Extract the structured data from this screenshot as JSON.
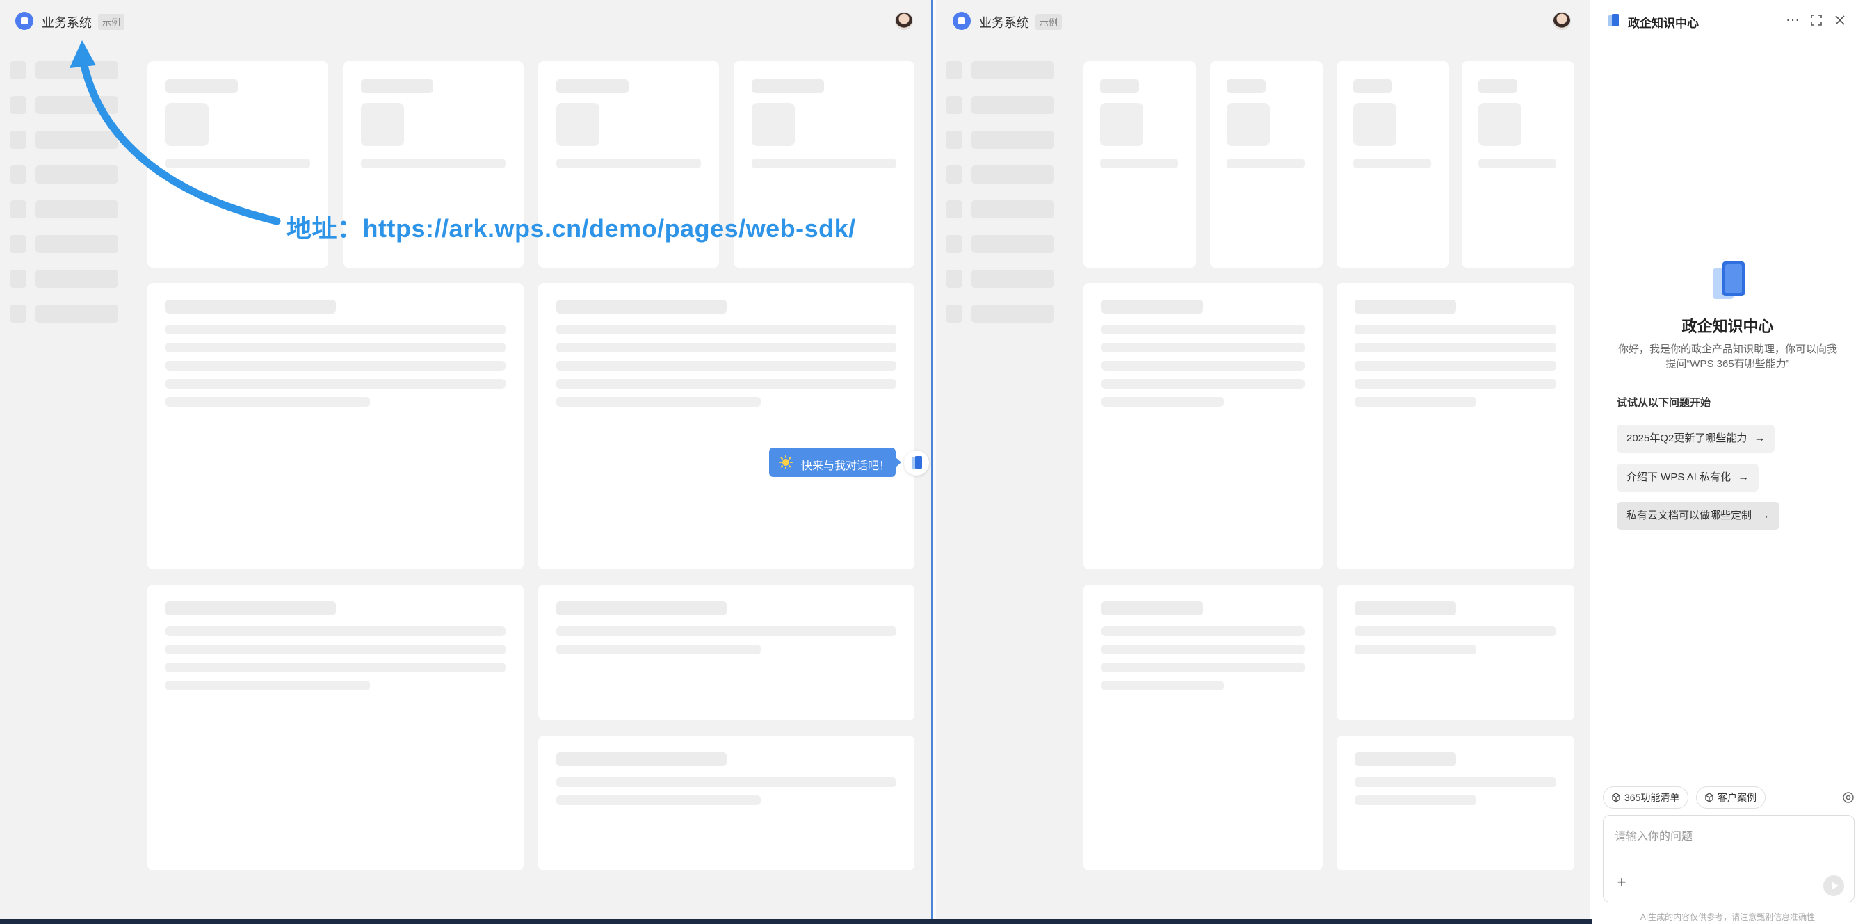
{
  "app": {
    "title": "业务系统",
    "tag": "示例"
  },
  "annotation": {
    "text": "地址：https://ark.wps.cn/demo/pages/web-sdk/",
    "color": "#2e94e8"
  },
  "float_bubble": {
    "label": "快来与我对话吧！"
  },
  "assistant": {
    "title": "政企知识中心",
    "hero_title": "政企知识中心",
    "hero_desc": "你好，我是你的政企产品知识助理，你可以向我提问“WPS 365有哪些能力”",
    "try_label": "试试从以下问题开始",
    "suggestions": [
      {
        "label": "2025年Q2更新了哪些能力",
        "arrow": "→"
      },
      {
        "label": "介绍下 WPS AI 私有化",
        "arrow": "→"
      },
      {
        "label": "私有云文档可以做哪些定制",
        "arrow": "→"
      }
    ],
    "chips": [
      {
        "label": "365功能清单"
      },
      {
        "label": "客户案例"
      }
    ],
    "input_placeholder": "请输入你的问题",
    "disclaimer": "AI生成的内容仅供参考，请注意甄别信息准确性",
    "header_icons": [
      "more-icon",
      "expand-icon",
      "close-icon"
    ]
  },
  "colors": {
    "accent": "#4d8fe8",
    "divider": "#4a86d8",
    "annotation": "#2e94e8"
  }
}
